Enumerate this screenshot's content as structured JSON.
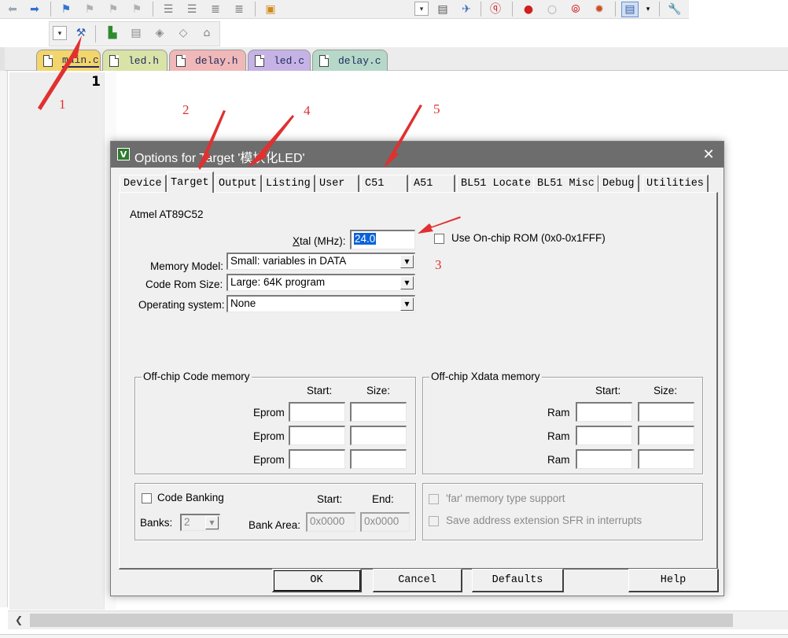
{
  "file_tabs": [
    {
      "label": "main.c",
      "color": "#f2d56b",
      "active": true
    },
    {
      "label": "led.h",
      "color": "#d9e3a8"
    },
    {
      "label": "delay.h",
      "color": "#f0b8b8"
    },
    {
      "label": "led.c",
      "color": "#c6b3e6"
    },
    {
      "label": "delay.c",
      "color": "#b6d8c9"
    }
  ],
  "editor": {
    "line_number": "1"
  },
  "annotations": [
    "1",
    "2",
    "3",
    "4",
    "5"
  ],
  "dialog": {
    "title": "Options for Target '模块化LED'",
    "icon_letter": "V",
    "close": "✕",
    "tabs": [
      "Device",
      "Target",
      "Output",
      "Listing",
      "User",
      "C51",
      "A51",
      "BL51 Locate",
      "BL51 Misc",
      "Debug",
      "Utilities"
    ],
    "active_tab": "Target",
    "device_name": "Atmel AT89C52",
    "xtal": {
      "label_prefix": "X",
      "label_rest": "tal (MHz):",
      "value": "24.0"
    },
    "onchip_rom": {
      "label": "Use On-chip ROM (0x0-0x1FFF)",
      "checked": false
    },
    "memory_model": {
      "label": "Memory Model:",
      "value": "Small: variables in DATA"
    },
    "code_rom_size": {
      "label": "Code Rom Size:",
      "value": "Large: 64K program"
    },
    "operating_system": {
      "label": "Operating system:",
      "value": "None"
    },
    "offchip_code": {
      "title": "Off-chip Code memory",
      "start_header": "Start:",
      "size_header": "Size:",
      "rows": [
        "Eprom",
        "Eprom",
        "Eprom"
      ]
    },
    "offchip_xdata": {
      "title": "Off-chip Xdata memory",
      "start_header": "Start:",
      "size_header": "Size:",
      "rows": [
        "Ram",
        "Ram",
        "Ram"
      ]
    },
    "code_banking": {
      "label": "Code Banking",
      "checked": false,
      "banks_label": "Banks:",
      "banks_value": "2",
      "bank_area_label": "Bank Area:",
      "start_header": "Start:",
      "end_header": "End:",
      "start_value": "0x0000",
      "end_value": "0x0000"
    },
    "far_memory": {
      "label": "'far' memory type support",
      "checked": false
    },
    "save_address": {
      "label": "Save address extension SFR in interrupts",
      "checked": false
    },
    "buttons": {
      "ok": "OK",
      "cancel": "Cancel",
      "defaults": "Defaults",
      "help": "Help"
    }
  },
  "colors": {
    "arrow": "#e03030",
    "title_bar": "#6d6d6d",
    "selection": "#0a62d9"
  },
  "icons": [
    "back-arrow-icon",
    "forward-arrow-icon",
    "bookmark-icon",
    "indent-icon",
    "comment-icon",
    "open-folder-icon",
    "debug-icon",
    "breakpoint-icon",
    "wrench-icon",
    "magic-wand-icon",
    "build-icon",
    "translate-icon",
    "load-icon",
    "download-icon"
  ]
}
